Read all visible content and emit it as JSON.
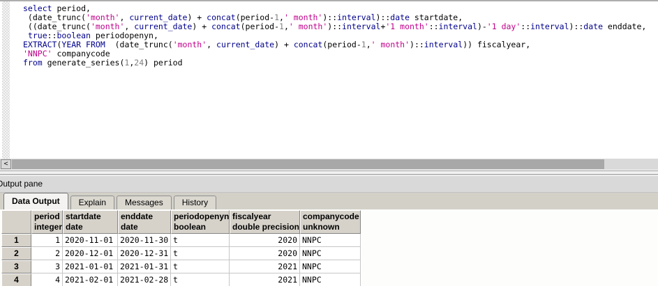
{
  "colors": {
    "keyword": "#00008b",
    "string": "#c0008c",
    "number": "#7f7f7f",
    "plain": "#000000"
  },
  "editor": {
    "lines": [
      [
        {
          "t": "select",
          "c": "k"
        },
        {
          "t": " period,",
          "c": "p"
        }
      ],
      [
        {
          "t": " (date_trunc(",
          "c": "p"
        },
        {
          "t": "'month'",
          "c": "s"
        },
        {
          "t": ", ",
          "c": "p"
        },
        {
          "t": "current_date",
          "c": "k"
        },
        {
          "t": ") + ",
          "c": "p"
        },
        {
          "t": "concat",
          "c": "k"
        },
        {
          "t": "(period-",
          "c": "p"
        },
        {
          "t": "1",
          "c": "n"
        },
        {
          "t": ",",
          "c": "p"
        },
        {
          "t": "' month'",
          "c": "s"
        },
        {
          "t": ")::",
          "c": "p"
        },
        {
          "t": "interval",
          "c": "k"
        },
        {
          "t": ")::",
          "c": "p"
        },
        {
          "t": "date",
          "c": "k"
        },
        {
          "t": " startdate,",
          "c": "p"
        }
      ],
      [
        {
          "t": " ((date_trunc(",
          "c": "p"
        },
        {
          "t": "'month'",
          "c": "s"
        },
        {
          "t": ", ",
          "c": "p"
        },
        {
          "t": "current_date",
          "c": "k"
        },
        {
          "t": ") + ",
          "c": "p"
        },
        {
          "t": "concat",
          "c": "k"
        },
        {
          "t": "(period-",
          "c": "p"
        },
        {
          "t": "1",
          "c": "n"
        },
        {
          "t": ",",
          "c": "p"
        },
        {
          "t": "' month'",
          "c": "s"
        },
        {
          "t": ")::",
          "c": "p"
        },
        {
          "t": "interval",
          "c": "k"
        },
        {
          "t": "+",
          "c": "p"
        },
        {
          "t": "'1 month'",
          "c": "s"
        },
        {
          "t": "::",
          "c": "p"
        },
        {
          "t": "interval",
          "c": "k"
        },
        {
          "t": ")-",
          "c": "p"
        },
        {
          "t": "'1 day'",
          "c": "s"
        },
        {
          "t": "::",
          "c": "p"
        },
        {
          "t": "interval",
          "c": "k"
        },
        {
          "t": ")::",
          "c": "p"
        },
        {
          "t": "date",
          "c": "k"
        },
        {
          "t": " enddate,",
          "c": "p"
        }
      ],
      [
        {
          "t": " ",
          "c": "p"
        },
        {
          "t": "true",
          "c": "k"
        },
        {
          "t": "::",
          "c": "p"
        },
        {
          "t": "boolean",
          "c": "k"
        },
        {
          "t": " periodopenyn,",
          "c": "p"
        }
      ],
      [
        {
          "t": "EXTRACT",
          "c": "k"
        },
        {
          "t": "(",
          "c": "p"
        },
        {
          "t": "YEAR",
          "c": "k"
        },
        {
          "t": " ",
          "c": "p"
        },
        {
          "t": "FROM",
          "c": "k"
        },
        {
          "t": "  (date_trunc(",
          "c": "p"
        },
        {
          "t": "'month'",
          "c": "s"
        },
        {
          "t": ", ",
          "c": "p"
        },
        {
          "t": "current_date",
          "c": "k"
        },
        {
          "t": ") + ",
          "c": "p"
        },
        {
          "t": "concat",
          "c": "k"
        },
        {
          "t": "(period-",
          "c": "p"
        },
        {
          "t": "1",
          "c": "n"
        },
        {
          "t": ",",
          "c": "p"
        },
        {
          "t": "' month'",
          "c": "s"
        },
        {
          "t": ")::",
          "c": "p"
        },
        {
          "t": "interval",
          "c": "k"
        },
        {
          "t": ")) fiscalyear,",
          "c": "p"
        }
      ],
      [
        {
          "t": "'NNPC'",
          "c": "s"
        },
        {
          "t": " companycode",
          "c": "p"
        }
      ],
      [
        {
          "t": "from",
          "c": "k"
        },
        {
          "t": " generate_series(",
          "c": "p"
        },
        {
          "t": "1",
          "c": "n"
        },
        {
          "t": ",",
          "c": "p"
        },
        {
          "t": "24",
          "c": "n"
        },
        {
          "t": ") period",
          "c": "p"
        }
      ]
    ]
  },
  "scrollbar": {
    "left_arrow": "<"
  },
  "output_pane": {
    "title": "Output pane",
    "tabs": [
      {
        "label": "Data Output",
        "active": true
      },
      {
        "label": "Explain",
        "active": false
      },
      {
        "label": "Messages",
        "active": false
      },
      {
        "label": "History",
        "active": false
      }
    ]
  },
  "table": {
    "columns": [
      {
        "name": "period",
        "type": "integer",
        "align": "right"
      },
      {
        "name": "startdate",
        "type": "date",
        "align": "left"
      },
      {
        "name": "enddate",
        "type": "date",
        "align": "left"
      },
      {
        "name": "periodopenyn",
        "type": "boolean",
        "align": "left"
      },
      {
        "name": "fiscalyear",
        "type": "double precision",
        "align": "right"
      },
      {
        "name": "companycode",
        "type": "unknown",
        "align": "left"
      }
    ],
    "rows": [
      {
        "num": "1",
        "cells": [
          "1",
          "2020-11-01",
          "2020-11-30",
          "t",
          "2020",
          "NNPC"
        ]
      },
      {
        "num": "2",
        "cells": [
          "2",
          "2020-12-01",
          "2020-12-31",
          "t",
          "2020",
          "NNPC"
        ]
      },
      {
        "num": "3",
        "cells": [
          "3",
          "2021-01-01",
          "2021-01-31",
          "t",
          "2021",
          "NNPC"
        ]
      },
      {
        "num": "4",
        "cells": [
          "4",
          "2021-02-01",
          "2021-02-28",
          "t",
          "2021",
          "NNPC"
        ]
      }
    ]
  }
}
